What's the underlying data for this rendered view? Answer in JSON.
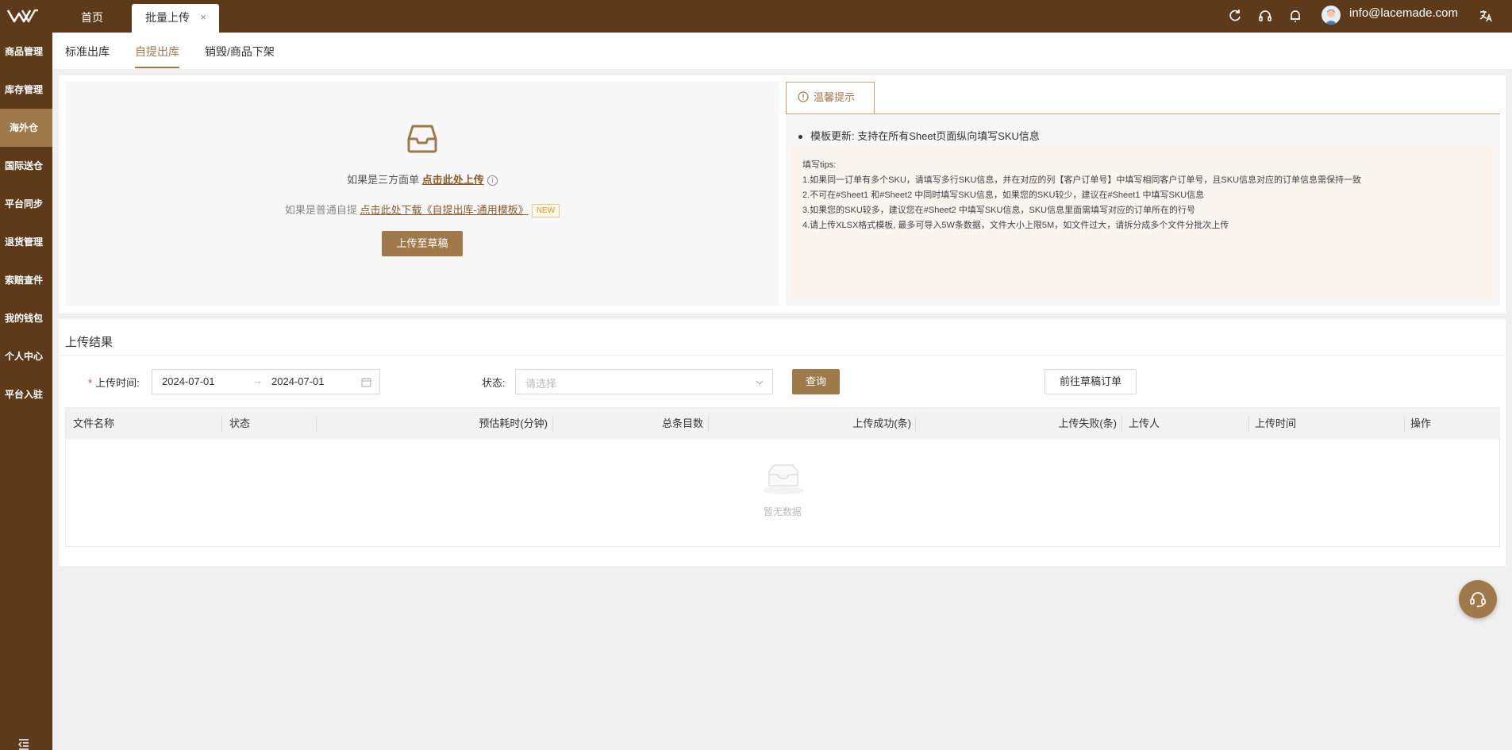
{
  "topbar": {
    "tabs": [
      {
        "label": "首页"
      },
      {
        "label": "批量上传",
        "close": "×"
      }
    ],
    "user_email": "info@lacemade.com"
  },
  "sidebar": {
    "items": [
      {
        "label": "商品管理"
      },
      {
        "label": "库存管理"
      },
      {
        "label": "海外仓",
        "active": true
      },
      {
        "label": "国际送仓"
      },
      {
        "label": "平台同步"
      },
      {
        "label": "退货管理"
      },
      {
        "label": "索赔查件"
      },
      {
        "label": "我的钱包"
      },
      {
        "label": "个人中心"
      },
      {
        "label": "平台入驻"
      }
    ]
  },
  "subnav": {
    "tabs": [
      {
        "label": "标准出库"
      },
      {
        "label": "自提出库",
        "active": true
      },
      {
        "label": "销毁/商品下架"
      }
    ]
  },
  "upload": {
    "line1_prefix": "如果是三方面单 ",
    "line1_link": "点击此处上传",
    "line2_prefix": "如果是普通自提 ",
    "line2_link": "点击此处下载《自提出库-通用模板》",
    "new_badge": "NEW",
    "draft_button": "上传至草稿"
  },
  "tips": {
    "tab_label": "温馨提示",
    "bullet": "模板更新: 支持在所有Sheet页面纵向填写SKU信息",
    "lines": [
      "填写tips:",
      "1.如果同一订单有多个SKU，请填写多行SKU信息，并在对应的列【客户订单号】中填写相同客户订单号，且SKU信息对应的订单信息需保持一致",
      "2.不可在#Sheet1 和#Sheet2 中同时填写SKU信息，如果您的SKU较少，建议在#Sheet1 中填写SKU信息",
      "3.如果您的SKU较多，建议您在#Sheet2 中填写SKU信息，SKU信息里面需填写对应的订单所在的行号",
      "4.请上传XLSX格式模板, 最多可导入5W条数据，文件大小上限5M，如文件过大，请拆分成多个文件分批次上传"
    ]
  },
  "results": {
    "title": "上传结果",
    "upload_time_label": "上传时间:",
    "required_mark": "*",
    "date_start": "2024-07-01",
    "date_arrow": "→",
    "date_end": "2024-07-01",
    "status_label": "状态:",
    "status_placeholder": "请选择",
    "query_button": "查询",
    "goto_button": "前往草稿订单",
    "columns": [
      "文件名称",
      "状态",
      "预估耗时(分钟)",
      "总条目数",
      "上传成功(条)",
      "上传失败(条)",
      "上传人",
      "上传时间",
      "操作"
    ],
    "empty_text": "暂无数据"
  },
  "colors": {
    "brand_dark": "#5d3b1a",
    "brand_accent": "#a0794b"
  },
  "icons": [
    "logo",
    "refresh-icon",
    "headset-icon",
    "bell-icon",
    "avatar",
    "translate-icon",
    "inbox-icon",
    "info-circle-icon",
    "calendar-icon",
    "chevron-down-icon",
    "empty-box-icon",
    "customer-service-icon",
    "menu-fold-icon"
  ]
}
